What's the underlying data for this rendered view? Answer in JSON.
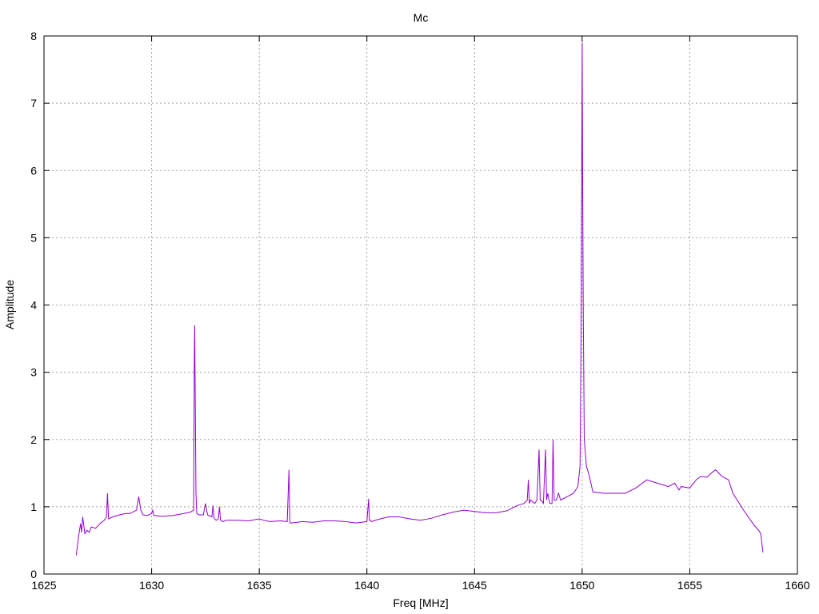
{
  "chart_data": {
    "type": "line",
    "title": "Mc",
    "xlabel": "Freq [MHz]",
    "ylabel": "Amplitude",
    "xlim": [
      1625,
      1660
    ],
    "ylim": [
      0,
      8
    ],
    "xticks": [
      1625,
      1630,
      1635,
      1640,
      1645,
      1650,
      1655,
      1660
    ],
    "xtick_labels": [
      "1625",
      "1630",
      "1635",
      "1640",
      "1645",
      "1650",
      "1655",
      "1660"
    ],
    "yticks": [
      0,
      1,
      2,
      3,
      4,
      5,
      6,
      7,
      8
    ],
    "ytick_labels": [
      "0",
      "1",
      "2",
      "3",
      "4",
      "5",
      "6",
      "7",
      "8"
    ],
    "grid": true,
    "color": "#9400d3",
    "series": [
      {
        "name": "",
        "x": [
          1626.5,
          1626.6,
          1626.7,
          1626.75,
          1626.8,
          1626.9,
          1627.0,
          1627.1,
          1627.2,
          1627.4,
          1627.6,
          1627.8,
          1627.9,
          1627.95,
          1628.0,
          1628.2,
          1628.5,
          1628.8,
          1629.0,
          1629.3,
          1629.4,
          1629.5,
          1629.6,
          1629.8,
          1630.0,
          1630.05,
          1630.1,
          1630.5,
          1631.0,
          1631.5,
          1631.8,
          1631.95,
          1631.98,
          1632.0,
          1632.03,
          1632.06,
          1632.1,
          1632.2,
          1632.4,
          1632.5,
          1632.6,
          1632.8,
          1632.85,
          1632.9,
          1633.0,
          1633.1,
          1633.15,
          1633.2,
          1633.3,
          1633.5,
          1634.0,
          1634.5,
          1635.0,
          1635.2,
          1635.5,
          1636.0,
          1636.3,
          1636.38,
          1636.42,
          1636.46,
          1636.5,
          1637.0,
          1637.5,
          1638.0,
          1638.5,
          1639.0,
          1639.5,
          1640.0,
          1640.08,
          1640.12,
          1640.16,
          1640.2,
          1640.5,
          1641.0,
          1641.5,
          1642.0,
          1642.5,
          1643.0,
          1643.5,
          1644.0,
          1644.5,
          1645.0,
          1645.5,
          1646.0,
          1646.5,
          1647.0,
          1647.3,
          1647.45,
          1647.5,
          1647.55,
          1647.6,
          1647.8,
          1647.9,
          1648.0,
          1648.05,
          1648.1,
          1648.2,
          1648.3,
          1648.35,
          1648.4,
          1648.5,
          1648.6,
          1648.65,
          1648.7,
          1648.8,
          1648.9,
          1649.0,
          1649.3,
          1649.6,
          1649.8,
          1649.9,
          1649.95,
          1650.0,
          1650.02,
          1650.05,
          1650.1,
          1650.2,
          1650.3,
          1650.5,
          1651.0,
          1651.5,
          1652.0,
          1652.5,
          1653.0,
          1653.2,
          1653.5,
          1654.0,
          1654.3,
          1654.5,
          1654.6,
          1655.0,
          1655.3,
          1655.5,
          1655.8,
          1656.0,
          1656.2,
          1656.5,
          1656.8,
          1657.0,
          1657.5,
          1658.0,
          1658.2,
          1658.3,
          1658.4
        ],
        "y": [
          0.28,
          0.55,
          0.75,
          0.62,
          0.85,
          0.6,
          0.65,
          0.62,
          0.7,
          0.68,
          0.75,
          0.8,
          0.85,
          1.2,
          0.82,
          0.85,
          0.88,
          0.9,
          0.9,
          0.95,
          1.15,
          0.95,
          0.88,
          0.87,
          0.9,
          0.95,
          0.87,
          0.86,
          0.87,
          0.9,
          0.92,
          0.95,
          3.1,
          3.7,
          2.5,
          1.2,
          0.9,
          0.88,
          0.88,
          1.05,
          0.88,
          0.85,
          1.02,
          0.83,
          0.8,
          0.82,
          1.0,
          0.8,
          0.78,
          0.8,
          0.8,
          0.79,
          0.82,
          0.8,
          0.78,
          0.79,
          0.78,
          1.55,
          0.76,
          0.76,
          0.76,
          0.78,
          0.77,
          0.79,
          0.79,
          0.78,
          0.76,
          0.78,
          1.12,
          0.8,
          0.8,
          0.78,
          0.81,
          0.85,
          0.85,
          0.82,
          0.8,
          0.83,
          0.88,
          0.92,
          0.95,
          0.93,
          0.91,
          0.91,
          0.94,
          1.02,
          1.05,
          1.1,
          1.4,
          1.05,
          1.1,
          1.05,
          1.1,
          1.85,
          1.1,
          1.1,
          1.05,
          1.85,
          1.1,
          1.2,
          1.05,
          1.05,
          2.0,
          1.1,
          1.1,
          1.2,
          1.1,
          1.15,
          1.2,
          1.3,
          1.6,
          3.5,
          7.9,
          6.1,
          4.0,
          2.0,
          1.6,
          1.5,
          1.22,
          1.2,
          1.2,
          1.2,
          1.28,
          1.4,
          1.38,
          1.35,
          1.3,
          1.35,
          1.25,
          1.3,
          1.28,
          1.4,
          1.45,
          1.44,
          1.5,
          1.55,
          1.45,
          1.4,
          1.2,
          0.95,
          0.72,
          0.65,
          0.6,
          0.32
        ]
      }
    ]
  }
}
